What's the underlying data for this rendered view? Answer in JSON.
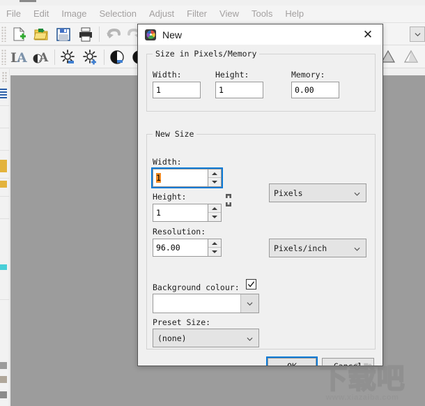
{
  "app": {
    "menus": [
      "File",
      "Edit",
      "Image",
      "Selection",
      "Adjust",
      "Filter",
      "View",
      "Tools",
      "Help"
    ],
    "toolbar_row1": [
      {
        "name": "new-file-icon",
        "title": "New"
      },
      {
        "name": "open-folder-icon",
        "title": "Open"
      },
      {
        "name": "save-icon",
        "title": "Save"
      },
      {
        "name": "print-icon",
        "title": "Print"
      },
      {
        "name": "undo-icon",
        "title": "Undo"
      },
      {
        "name": "redo-icon",
        "title": "Redo"
      }
    ],
    "toolbar_row2": [
      {
        "name": "text-style-icon",
        "title": "Text"
      },
      {
        "name": "font-effect-icon",
        "title": "Font effect"
      },
      {
        "name": "brightness-down-icon",
        "title": "Brightness"
      },
      {
        "name": "brightness-up-icon",
        "title": "Brightness up"
      },
      {
        "name": "contrast-icon",
        "title": "Contrast"
      },
      {
        "name": "contrast-alt-icon",
        "title": "Contrast alt"
      }
    ],
    "right_tools": [
      {
        "name": "triangle-shape-icon",
        "title": "Triangle"
      },
      {
        "name": "triangle-outline-shape-icon",
        "title": "Triangle outline"
      }
    ]
  },
  "dialog": {
    "title": "New",
    "icon": "app-palette-icon",
    "close_label": "✕",
    "groups": {
      "size_memory": {
        "legend": "Size in Pixels/Memory",
        "width_label": "Width:",
        "width_value": "1",
        "height_label": "Height:",
        "height_value": "1",
        "memory_label": "Memory:",
        "memory_value": "0.00"
      },
      "new_size": {
        "legend": "New Size",
        "width_label": "Width:",
        "width_value": "1",
        "height_label": "Height:",
        "height_value": "1",
        "resolution_label": "Resolution:",
        "resolution_value": "96.00",
        "units_value": "Pixels",
        "resolution_units_value": "Pixels/inch",
        "background_label": "Background colour:",
        "background_checked": true,
        "background_color": "#ffffff",
        "preset_label": "Preset Size:",
        "preset_value": "(none)",
        "link_icon": "chain-link-icon"
      }
    },
    "buttons": {
      "ok": "OK",
      "cancel": "Cancel"
    }
  },
  "watermark": {
    "text": "下载吧",
    "url": "www.xiazaiba.com"
  },
  "colors": {
    "focus_blue": "#0d7ad6",
    "canvas_gray": "#9c9c9c",
    "dialog_bg": "#f0f0f0",
    "selection_orange": "#f08a24"
  }
}
